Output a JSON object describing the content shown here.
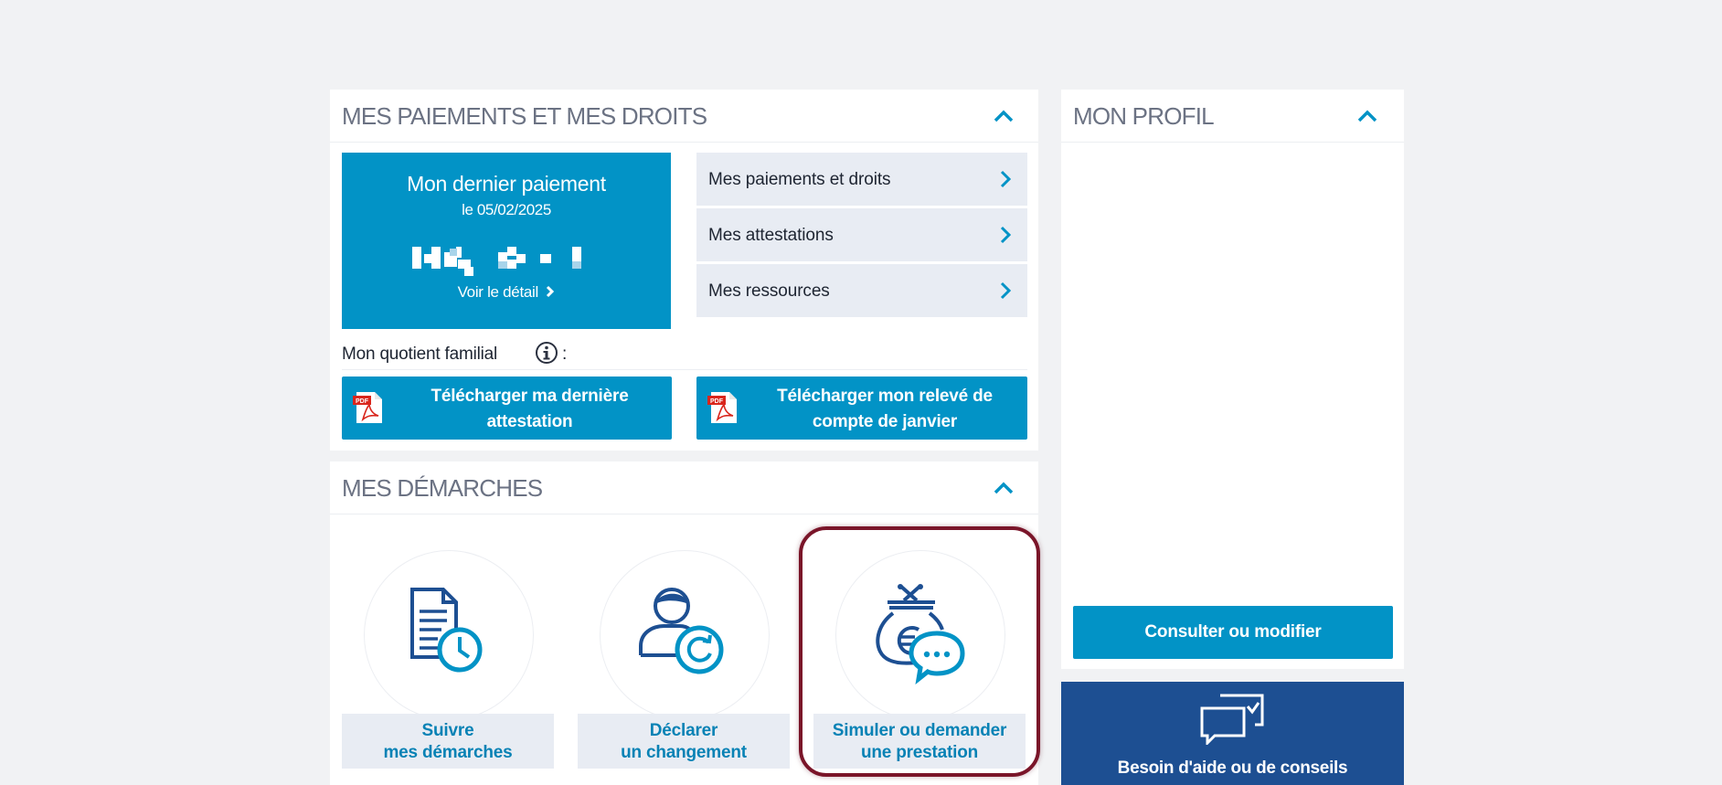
{
  "payments_panel": {
    "title": "MES PAIEMENTS ET MES DROITS",
    "last_payment": {
      "title": "Mon dernier paiement",
      "date": "le 05/02/2025",
      "detail_link": "Voir le détail"
    },
    "links": [
      {
        "label": "Mes paiements et droits"
      },
      {
        "label": "Mes attestations"
      },
      {
        "label": "Mes ressources"
      }
    ],
    "quotient_label": "Mon quotient familial",
    "quotient_colon": ":",
    "downloads": [
      {
        "label_line1": "Télécharger ma dernière",
        "label_line2": "attestation",
        "icon": "pdf-icon"
      },
      {
        "label_line1": "Télécharger mon relevé de",
        "label_line2": "compte de janvier",
        "icon": "pdf-icon"
      }
    ]
  },
  "demarches_panel": {
    "title": "MES DÉMARCHES",
    "items": [
      {
        "line1": "Suivre",
        "line2": "mes démarches",
        "icon": "document-clock-icon"
      },
      {
        "line1": "Déclarer",
        "line2": "un changement",
        "icon": "person-refresh-icon"
      },
      {
        "line1": "Simuler ou demander",
        "line2": "une prestation",
        "icon": "money-bag-chat-icon"
      }
    ]
  },
  "profile_panel": {
    "title": "MON PROFIL",
    "consult_button": "Consulter ou modifier"
  },
  "help": {
    "label": "Besoin d'aide ou de conseils",
    "icon": "chat-bubbles-icon"
  },
  "colors": {
    "accent_blue": "#0293c6",
    "link_blue": "#0882b5",
    "dark_blue": "#1d4f92",
    "highlight": "#7a1529",
    "background": "#f1f2f4"
  }
}
